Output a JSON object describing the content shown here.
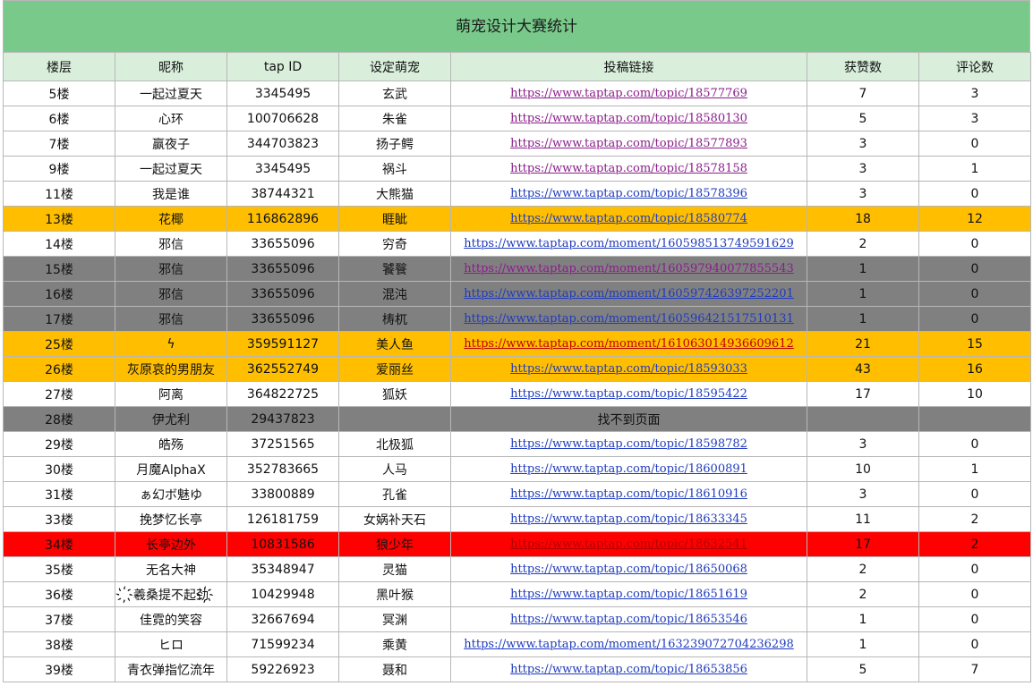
{
  "title": "萌宠设计大赛统计",
  "headers": [
    "楼层",
    "昵称",
    "tap ID",
    "设定萌宠",
    "投稿链接",
    "获赞数",
    "评论数"
  ],
  "colors": {
    "title_bg": "#79c98b",
    "header_bg": "#d9efdc",
    "orange": "#ffbf00",
    "gray": "#808080",
    "red": "#ff0000"
  },
  "rows": [
    {
      "floor": "5楼",
      "nick": "一起过夏天",
      "tapid": "3345495",
      "pet": "玄武",
      "link": "https://www.taptap.com/topic/18577769",
      "likes": "7",
      "comments": "3",
      "style": "",
      "linkstyle": "visited"
    },
    {
      "floor": "6楼",
      "nick": "心环",
      "tapid": "100706628",
      "pet": "朱雀",
      "link": "https://www.taptap.com/topic/18580130",
      "likes": "5",
      "comments": "3",
      "style": "",
      "linkstyle": "visited"
    },
    {
      "floor": "7楼",
      "nick": "赢夜子",
      "tapid": "344703823",
      "pet": "扬子鳄",
      "link": "https://www.taptap.com/topic/18577893",
      "likes": "3",
      "comments": "0",
      "style": "",
      "linkstyle": "visited"
    },
    {
      "floor": "9楼",
      "nick": "一起过夏天",
      "tapid": "3345495",
      "pet": "祸斗",
      "link": "https://www.taptap.com/topic/18578158",
      "likes": "3",
      "comments": "1",
      "style": "",
      "linkstyle": "visited"
    },
    {
      "floor": "11楼",
      "nick": "我是谁",
      "tapid": "38744321",
      "pet": "大熊猫",
      "link": "https://www.taptap.com/topic/18578396",
      "likes": "3",
      "comments": "0",
      "style": "",
      "linkstyle": ""
    },
    {
      "floor": "13楼",
      "nick": "花椰",
      "tapid": "116862896",
      "pet": "睚眦",
      "link": "https://www.taptap.com/topic/18580774",
      "likes": "18",
      "comments": "12",
      "style": "orange",
      "linkstyle": ""
    },
    {
      "floor": "14楼",
      "nick": "邪信",
      "tapid": "33655096",
      "pet": "穷奇",
      "link": "https://www.taptap.com/moment/16059851374959162​9",
      "likes": "2",
      "comments": "0",
      "style": "",
      "linkstyle": ""
    },
    {
      "floor": "15楼",
      "nick": "邪信",
      "tapid": "33655096",
      "pet": "饕餮",
      "link": "https://www.taptap.com/moment/160597940077855543",
      "likes": "1",
      "comments": "0",
      "style": "gray",
      "linkstyle": "visited"
    },
    {
      "floor": "16楼",
      "nick": "邪信",
      "tapid": "33655096",
      "pet": "混沌",
      "link": "https://www.taptap.com/moment/160597426397252201",
      "likes": "1",
      "comments": "0",
      "style": "gray",
      "linkstyle": ""
    },
    {
      "floor": "17楼",
      "nick": "邪信",
      "tapid": "33655096",
      "pet": "梼杌",
      "link": "https://www.taptap.com/moment/160596421517510131",
      "likes": "1",
      "comments": "0",
      "style": "gray",
      "linkstyle": ""
    },
    {
      "floor": "25楼",
      "nick": "ϟ",
      "tapid": "359591127",
      "pet": "美人鱼",
      "link": "https://www.taptap.com/moment/161063014936609612",
      "likes": "21",
      "comments": "15",
      "style": "orange",
      "linkstyle": "redlink"
    },
    {
      "floor": "26楼",
      "nick": "灰原哀的男朋友",
      "tapid": "362552749",
      "pet": "爱丽丝",
      "link": "https://www.taptap.com/topic/18593033",
      "likes": "43",
      "comments": "16",
      "style": "orange",
      "linkstyle": ""
    },
    {
      "floor": "27楼",
      "nick": "阿离",
      "tapid": "364822725",
      "pet": "狐妖",
      "link": "https://www.taptap.com/topic/18595422",
      "likes": "17",
      "comments": "10",
      "style": "",
      "linkstyle": ""
    },
    {
      "floor": "28楼",
      "nick": "伊尤利",
      "tapid": "29437823",
      "pet": "",
      "link": "找不到页面",
      "likes": "",
      "comments": "",
      "style": "gray",
      "linkstyle": "plain"
    },
    {
      "floor": "29楼",
      "nick": "皓殇",
      "tapid": "37251565",
      "pet": "北极狐",
      "link": "https://www.taptap.com/topic/18598782",
      "likes": "3",
      "comments": "0",
      "style": "",
      "linkstyle": ""
    },
    {
      "floor": "30楼",
      "nick": "月魔AlphaX",
      "tapid": "352783665",
      "pet": "人马",
      "link": "https://www.taptap.com/topic/18600891",
      "likes": "10",
      "comments": "1",
      "style": "",
      "linkstyle": ""
    },
    {
      "floor": "31楼",
      "nick": "ぁ幻ボ魅ゆ",
      "tapid": "33800889",
      "pet": "孔雀",
      "link": "https://www.taptap.com/topic/18610916",
      "likes": "3",
      "comments": "0",
      "style": "",
      "linkstyle": ""
    },
    {
      "floor": "33楼",
      "nick": "挽梦忆长亭",
      "tapid": "126181759",
      "pet": "女娲补天石",
      "link": "https://www.taptap.com/topic/18633345",
      "likes": "11",
      "comments": "2",
      "style": "",
      "linkstyle": ""
    },
    {
      "floor": "34楼",
      "nick": "长亭边外",
      "tapid": "10831586",
      "pet": "狼少年",
      "link": "https://www.taptap.com/topic/18632541",
      "likes": "17",
      "comments": "2",
      "style": "red",
      "linkstyle": ""
    },
    {
      "floor": "35楼",
      "nick": "无名大神",
      "tapid": "35348947",
      "pet": "灵猫",
      "link": "https://www.taptap.com/topic/18650068",
      "likes": "2",
      "comments": "0",
      "style": "",
      "linkstyle": ""
    },
    {
      "floor": "36楼",
      "nick": "҉羲桑提不起劲҉",
      "tapid": "10429948",
      "pet": "黑叶猴",
      "link": "https://www.taptap.com/topic/18651619",
      "likes": "2",
      "comments": "0",
      "style": "",
      "linkstyle": ""
    },
    {
      "floor": "37楼",
      "nick": "佳霓的笑容",
      "tapid": "32667694",
      "pet": "冥渊",
      "link": "https://www.taptap.com/topic/18653546",
      "likes": "1",
      "comments": "0",
      "style": "",
      "linkstyle": ""
    },
    {
      "floor": "38楼",
      "nick": "ヒロ",
      "tapid": "71599234",
      "pet": "乘黄",
      "link": "https://www.taptap.com/moment/163239072704236298",
      "likes": "1",
      "comments": "0",
      "style": "",
      "linkstyle": ""
    },
    {
      "floor": "39楼",
      "nick": "青衣弹指忆流年",
      "tapid": "59226923",
      "pet": "聂和",
      "link": "https://www.taptap.com/topic/18653856",
      "likes": "5",
      "comments": "7",
      "style": "",
      "linkstyle": ""
    }
  ]
}
